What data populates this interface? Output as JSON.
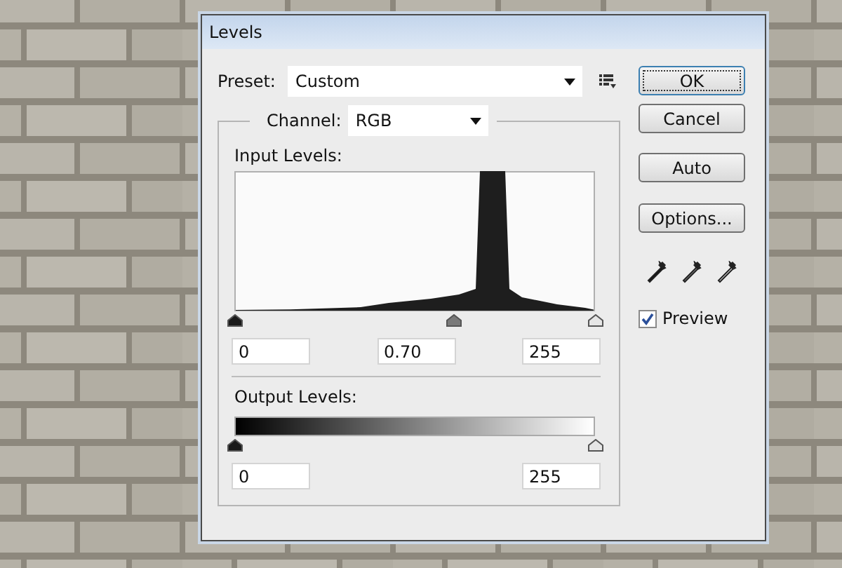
{
  "window": {
    "title": "Levels"
  },
  "preset": {
    "label": "Preset:",
    "value": "Custom"
  },
  "channel": {
    "label": "Channel:",
    "value": "RGB"
  },
  "input_levels": {
    "label": "Input Levels:",
    "sliders": [
      {
        "kind": "black",
        "level": 0
      },
      {
        "kind": "gray",
        "level": 0.61
      },
      {
        "kind": "white",
        "level": 1
      }
    ],
    "fields": [
      {
        "value": "0"
      },
      {
        "value": "0.70"
      },
      {
        "value": "255"
      }
    ]
  },
  "output_levels": {
    "label": "Output Levels:",
    "sliders": [
      {
        "kind": "black",
        "level": 0
      },
      {
        "kind": "white",
        "level": 1
      }
    ],
    "fields": [
      {
        "value": "0"
      },
      {
        "value": "255"
      }
    ]
  },
  "buttons": [
    {
      "label": "OK",
      "default": true
    },
    {
      "label": "Cancel",
      "default": false
    },
    {
      "label": "Auto",
      "default": false
    },
    {
      "label": "Options...",
      "default": false
    }
  ],
  "eyedroppers": [
    {
      "kind": "black"
    },
    {
      "kind": "gray"
    },
    {
      "kind": "white"
    }
  ],
  "preview": {
    "label": "Preview",
    "checked": true
  }
}
